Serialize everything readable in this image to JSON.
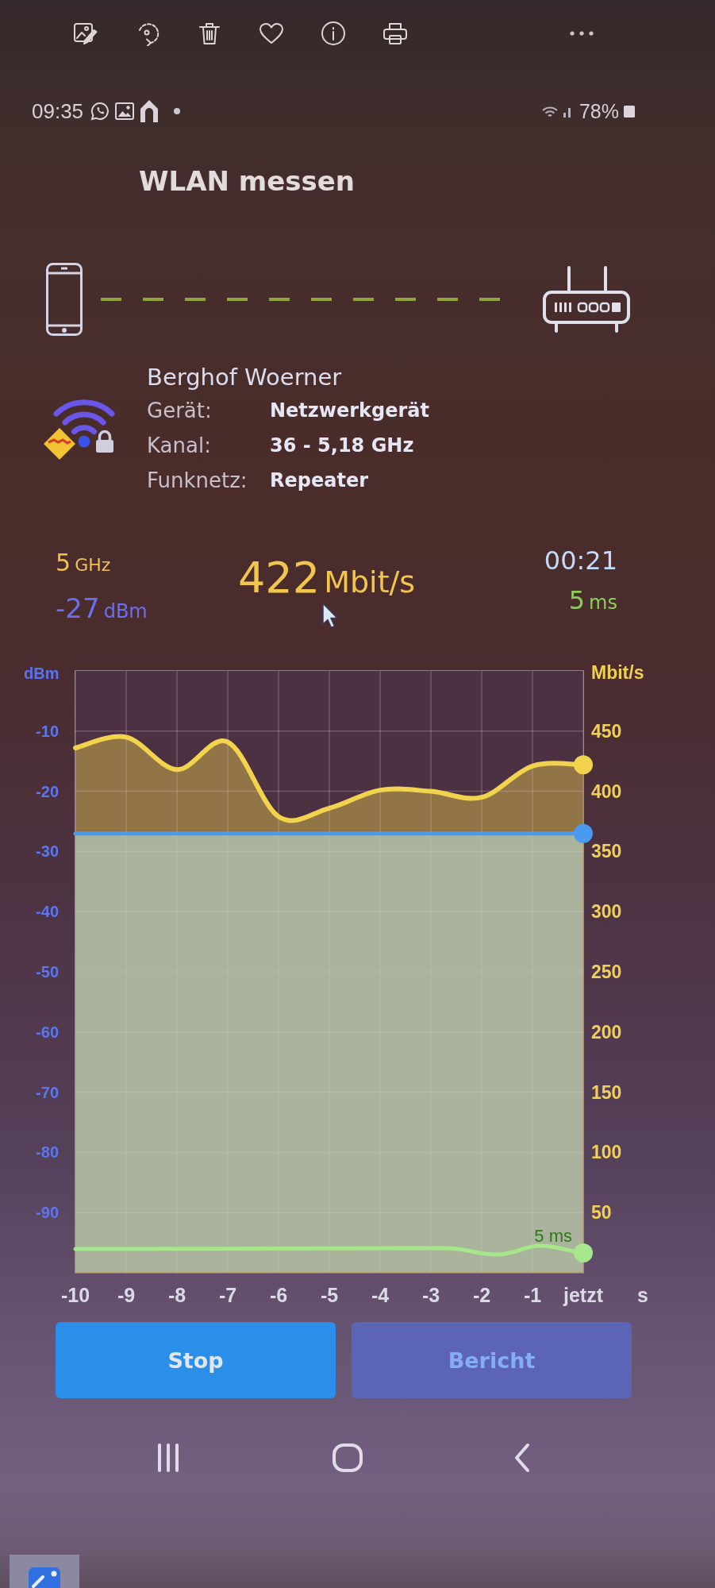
{
  "status_bar": {
    "time": "09:35",
    "battery": "78%"
  },
  "title": "WLAN messen",
  "network": {
    "name": "Berghof Woerner",
    "details": [
      {
        "label": "Gerät:",
        "value": "Netzwerkgerät"
      },
      {
        "label": "Kanal:",
        "value": "36 - 5,18 GHz"
      },
      {
        "label": "Funknetz:",
        "value": "Repeater"
      }
    ]
  },
  "readings": {
    "band": {
      "value": "5",
      "unit": "GHz"
    },
    "signal": {
      "value": "-27",
      "unit": "dBm"
    },
    "speed": {
      "value": "422",
      "unit": "Mbit/s"
    },
    "elapsed": "00:21",
    "latency": {
      "value": "5",
      "unit": "ms"
    }
  },
  "chart": {
    "chart_data": {
      "type": "area",
      "xlabel": "s",
      "x": [
        -10,
        -9,
        -8,
        -7,
        -6,
        -5,
        -4,
        -3,
        -2,
        -1,
        0
      ],
      "xlim": [
        -10,
        0
      ],
      "ylim": [
        -100,
        0
      ],
      "y2lim": [
        0,
        500
      ],
      "xticks": [
        -10,
        -9,
        -8,
        -7,
        -6,
        -5,
        -4,
        -3,
        -2,
        -1,
        {
          "value": 0,
          "label": "jetzt"
        }
      ],
      "yticks": [
        -10,
        -20,
        -30,
        -40,
        -50,
        -60,
        -70,
        -80,
        -90
      ],
      "y2ticks": [
        450,
        400,
        350,
        300,
        250,
        200,
        150,
        100,
        50
      ],
      "grid": true,
      "series": [
        {
          "name": "Mbit/s",
          "color": "#f2d34e",
          "axis": "y2",
          "values": [
            436,
            445,
            418,
            441,
            379,
            386,
            401,
            400,
            395,
            421,
            422
          ]
        },
        {
          "name": "dBm",
          "color": "#4a9af0",
          "values": [
            -27,
            -27,
            -27,
            -27,
            -27,
            -27,
            -27,
            -27,
            -27,
            -27,
            -27
          ]
        }
      ],
      "annotations": [
        {
          "text": "5 ms",
          "x": 0
        }
      ]
    }
  },
  "buttons": [
    {
      "label": "Stop",
      "kind": "primary"
    },
    {
      "label": "Bericht",
      "kind": "secondary"
    }
  ]
}
